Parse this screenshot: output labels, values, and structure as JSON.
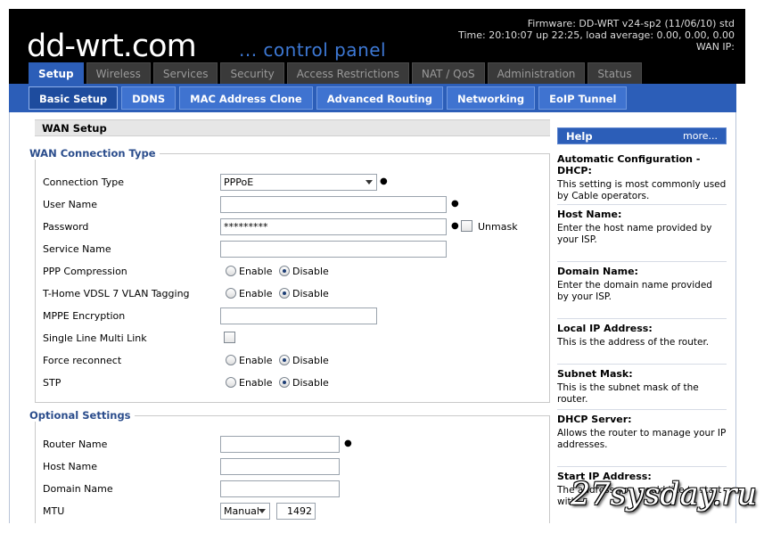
{
  "header": {
    "logo": "dd-wrt.com",
    "tagline": "... control panel",
    "firmware": "Firmware: DD-WRT v24-sp2 (11/06/10) std",
    "time": "Time: 20:10:07 up 22:25, load average: 0.00, 0.00, 0.00",
    "wan_ip": "WAN IP:"
  },
  "main_tabs": [
    {
      "label": "Setup",
      "active": true
    },
    {
      "label": "Wireless"
    },
    {
      "label": "Services"
    },
    {
      "label": "Security"
    },
    {
      "label": "Access Restrictions"
    },
    {
      "label": "NAT / QoS"
    },
    {
      "label": "Administration"
    },
    {
      "label": "Status"
    }
  ],
  "sub_tabs": [
    {
      "label": "Basic Setup",
      "active": true
    },
    {
      "label": "DDNS"
    },
    {
      "label": "MAC Address Clone"
    },
    {
      "label": "Advanced Routing"
    },
    {
      "label": "Networking"
    },
    {
      "label": "EoIP Tunnel"
    }
  ],
  "wan_setup": {
    "title": "WAN Setup",
    "connection_type_legend": "WAN Connection Type",
    "connection_type": {
      "label": "Connection Type",
      "value": "PPPoE"
    },
    "user_name": {
      "label": "User Name",
      "value": ""
    },
    "password": {
      "label": "Password",
      "value": "*********",
      "unmask_label": "Unmask"
    },
    "service_name": {
      "label": "Service Name",
      "value": ""
    },
    "ppp_compression": {
      "label": "PPP Compression",
      "selected": "Disable"
    },
    "vlan_tagging": {
      "label": "T-Home VDSL 7 VLAN Tagging",
      "selected": "Disable"
    },
    "mppe_encryption": {
      "label": "MPPE Encryption",
      "value": ""
    },
    "single_line_multi_link": {
      "label": "Single Line Multi Link",
      "checked": false
    },
    "force_reconnect": {
      "label": "Force reconnect",
      "selected": "Disable"
    },
    "stp": {
      "label": "STP",
      "selected": "Disable"
    },
    "enable_label": "Enable",
    "disable_label": "Disable"
  },
  "optional_settings": {
    "legend": "Optional Settings",
    "router_name": {
      "label": "Router Name",
      "value": ""
    },
    "host_name": {
      "label": "Host Name",
      "value": ""
    },
    "domain_name": {
      "label": "Domain Name",
      "value": ""
    },
    "mtu": {
      "label": "MTU",
      "mode": "Manual",
      "value": "1492"
    }
  },
  "help": {
    "title": "Help",
    "more": "more...",
    "items": [
      {
        "title": "Automatic Configuration - DHCP:",
        "text": "This setting is most commonly used by Cable operators."
      },
      {
        "title": "Host Name:",
        "text": "Enter the host name provided by your ISP."
      },
      {
        "title": "Domain Name:",
        "text": "Enter the domain name provided by your ISP."
      },
      {
        "title": "Local IP Address:",
        "text": "This is the address of the router."
      },
      {
        "title": "Subnet Mask:",
        "text": "This is the subnet mask of the router."
      },
      {
        "title": "DHCP Server:",
        "text": "Allows the router to manage your IP addresses."
      },
      {
        "title": "Start IP Address:",
        "text": "The address you would like to start with."
      }
    ]
  },
  "watermark": "27sysday.ru",
  "colors": {
    "header_bg": "#000000",
    "accent": "#2c5eb8",
    "legend": "#2b4d8c"
  },
  "icons": [
    "chevron-down-icon",
    "radio-icon",
    "checkbox-icon"
  ]
}
